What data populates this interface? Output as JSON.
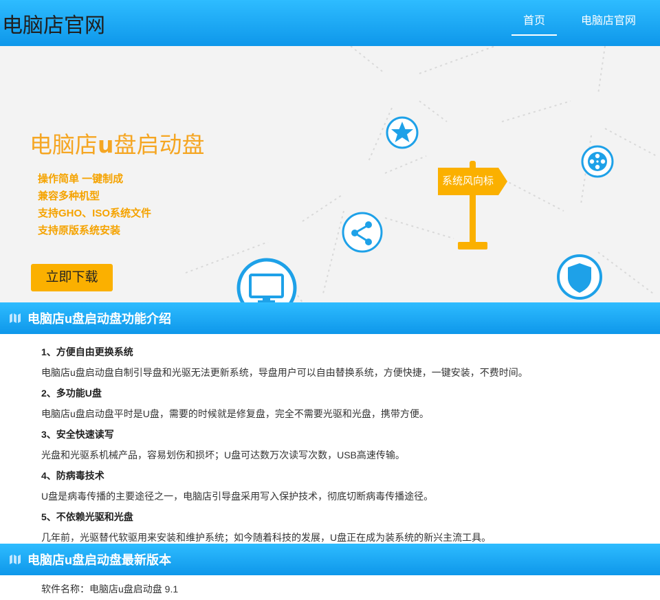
{
  "header": {
    "logo": "电脑店官网",
    "nav": [
      {
        "label": "首页",
        "active": true
      },
      {
        "label": "电脑店官网",
        "active": false
      }
    ]
  },
  "banner": {
    "title_prefix": "电脑店",
    "title_bold": "u",
    "title_suffix": "盘启动盘",
    "features": [
      "操作简单  一键制成",
      "兼容多种机型",
      "支持GHO、ISO系统文件",
      "支持原版系统安装"
    ],
    "download_label": "立即下载",
    "sign_label": "系统风向标",
    "icons": [
      "star-icon",
      "film-reel-icon",
      "share-icon",
      "monitor-icon",
      "shield-icon"
    ]
  },
  "section1": {
    "title": "电脑店u盘启动盘功能介绍",
    "items": [
      {
        "heading": "1、方便自由更换系统",
        "text": "电脑店u盘启动盘自制引导盘和光驱无法更新系统，导盘用户可以自由替换系统，方便快捷，一键安装，不费时间。"
      },
      {
        "heading": "2、多功能U盘",
        "text": "电脑店u盘启动盘平时是U盘，需要的时候就是修复盘，完全不需要光驱和光盘，携带方便。"
      },
      {
        "heading": "3、安全快速读写",
        "text": "光盘和光驱系机械产品，容易划伤和损坏；U盘可达数万次读写次数，USB高速传输。"
      },
      {
        "heading": "4、防病毒技术",
        "text": "U盘是病毒传播的主要途径之一，电脑店引导盘采用写入保护技术，彻底切断病毒传播途径。"
      },
      {
        "heading": "5、不依赖光驱和光盘",
        "text": "几年前，光驱替代软驱用来安装和维护系统；如今随着科技的发展，U盘正在成为装系统的新兴主流工具。"
      }
    ]
  },
  "section2": {
    "title": "电脑店u盘启动盘最新版本",
    "first_line": "软件名称：电脑店u盘启动盘 9.1"
  },
  "colors": {
    "header_blue": "#1aa8f5",
    "accent_orange": "#f5a623",
    "icon_blue": "#1ea1e8"
  }
}
